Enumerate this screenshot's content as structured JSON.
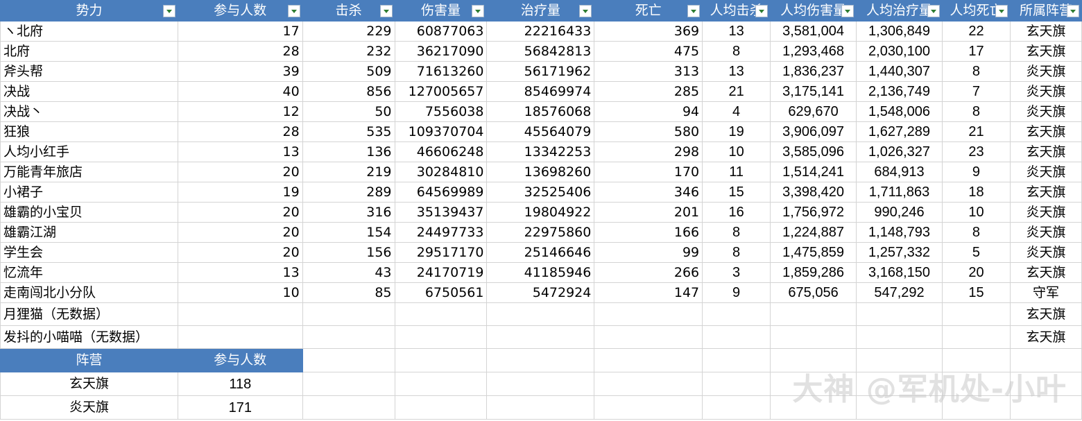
{
  "headers": [
    "势力",
    "参与人数",
    "击杀",
    "伤害量",
    "治疗量",
    "死亡",
    "人均击杀",
    "人均伤害量",
    "人均治疗量",
    "人均死亡",
    "所属阵营"
  ],
  "rows": [
    {
      "name": "ヽ北府",
      "members": "17",
      "kills": "229",
      "damage": "60877063",
      "heal": "22216433",
      "deaths": "369",
      "avg_kills": "13",
      "avg_damage": "3,581,004",
      "avg_heal": "1,306,849",
      "avg_deaths": "22",
      "camp": "玄天旗"
    },
    {
      "name": "北府",
      "members": "28",
      "kills": "232",
      "damage": "36217090",
      "heal": "56842813",
      "deaths": "475",
      "avg_kills": "8",
      "avg_damage": "1,293,468",
      "avg_heal": "2,030,100",
      "avg_deaths": "17",
      "camp": "玄天旗"
    },
    {
      "name": "斧头帮",
      "members": "39",
      "kills": "509",
      "damage": "71613260",
      "heal": "56171962",
      "deaths": "313",
      "avg_kills": "13",
      "avg_damage": "1,836,237",
      "avg_heal": "1,440,307",
      "avg_deaths": "8",
      "camp": "炎天旗"
    },
    {
      "name": "决战",
      "members": "40",
      "kills": "856",
      "damage": "127005657",
      "heal": "85469974",
      "deaths": "285",
      "avg_kills": "21",
      "avg_damage": "3,175,141",
      "avg_heal": "2,136,749",
      "avg_deaths": "7",
      "camp": "炎天旗"
    },
    {
      "name": "决战丶",
      "members": "12",
      "kills": "50",
      "damage": "7556038",
      "heal": "18576068",
      "deaths": "94",
      "avg_kills": "4",
      "avg_damage": "629,670",
      "avg_heal": "1,548,006",
      "avg_deaths": "8",
      "camp": "炎天旗"
    },
    {
      "name": "狂狼",
      "members": "28",
      "kills": "535",
      "damage": "109370704",
      "heal": "45564079",
      "deaths": "580",
      "avg_kills": "19",
      "avg_damage": "3,906,097",
      "avg_heal": "1,627,289",
      "avg_deaths": "21",
      "camp": "玄天旗"
    },
    {
      "name": "人均小红手",
      "members": "13",
      "kills": "136",
      "damage": "46606248",
      "heal": "13342253",
      "deaths": "298",
      "avg_kills": "10",
      "avg_damage": "3,585,096",
      "avg_heal": "1,026,327",
      "avg_deaths": "23",
      "camp": "玄天旗"
    },
    {
      "name": "万能青年旅店",
      "members": "20",
      "kills": "219",
      "damage": "30284810",
      "heal": "13698260",
      "deaths": "170",
      "avg_kills": "11",
      "avg_damage": "1,514,241",
      "avg_heal": "684,913",
      "avg_deaths": "9",
      "camp": "炎天旗"
    },
    {
      "name": "小裙子",
      "members": "19",
      "kills": "289",
      "damage": "64569989",
      "heal": "32525406",
      "deaths": "346",
      "avg_kills": "15",
      "avg_damage": "3,398,420",
      "avg_heal": "1,711,863",
      "avg_deaths": "18",
      "camp": "玄天旗"
    },
    {
      "name": "雄霸的小宝贝",
      "members": "20",
      "kills": "316",
      "damage": "35139437",
      "heal": "19804922",
      "deaths": "201",
      "avg_kills": "16",
      "avg_damage": "1,756,972",
      "avg_heal": "990,246",
      "avg_deaths": "10",
      "camp": "炎天旗"
    },
    {
      "name": "雄霸江湖",
      "members": "20",
      "kills": "154",
      "damage": "24497733",
      "heal": "22975860",
      "deaths": "166",
      "avg_kills": "8",
      "avg_damage": "1,224,887",
      "avg_heal": "1,148,793",
      "avg_deaths": "8",
      "camp": "炎天旗"
    },
    {
      "name": "学生会",
      "members": "20",
      "kills": "156",
      "damage": "29517170",
      "heal": "25146646",
      "deaths": "99",
      "avg_kills": "8",
      "avg_damage": "1,475,859",
      "avg_heal": "1,257,332",
      "avg_deaths": "5",
      "camp": "炎天旗"
    },
    {
      "name": "忆流年",
      "members": "13",
      "kills": "43",
      "damage": "24170719",
      "heal": "41185946",
      "deaths": "266",
      "avg_kills": "3",
      "avg_damage": "1,859,286",
      "avg_heal": "3,168,150",
      "avg_deaths": "20",
      "camp": "玄天旗"
    },
    {
      "name": "走南闯北小分队",
      "members": "10",
      "kills": "85",
      "damage": "6750561",
      "heal": "5472924",
      "deaths": "147",
      "avg_kills": "9",
      "avg_damage": "675,056",
      "avg_heal": "547,292",
      "avg_deaths": "15",
      "camp": "守军"
    },
    {
      "name": "月狸猫（无数据）",
      "members": "",
      "kills": "",
      "damage": "",
      "heal": "",
      "deaths": "",
      "avg_kills": "",
      "avg_damage": "",
      "avg_heal": "",
      "avg_deaths": "",
      "camp": "玄天旗"
    },
    {
      "name": "发抖的小喵喵（无数据）",
      "members": "",
      "kills": "",
      "damage": "",
      "heal": "",
      "deaths": "",
      "avg_kills": "",
      "avg_damage": "",
      "avg_heal": "",
      "avg_deaths": "",
      "camp": "玄天旗"
    }
  ],
  "summary": {
    "headers": [
      "阵营",
      "参与人数"
    ],
    "rows": [
      {
        "camp": "玄天旗",
        "count": "118"
      },
      {
        "camp": "炎天旗",
        "count": "171"
      }
    ]
  },
  "watermark": "大神 @军机处-小叶",
  "colors": {
    "header_bg": "#4a7ebd",
    "header_text": "#ffffff",
    "grid": "#d4d4d4",
    "filter_arrow": "#2f7d32"
  }
}
